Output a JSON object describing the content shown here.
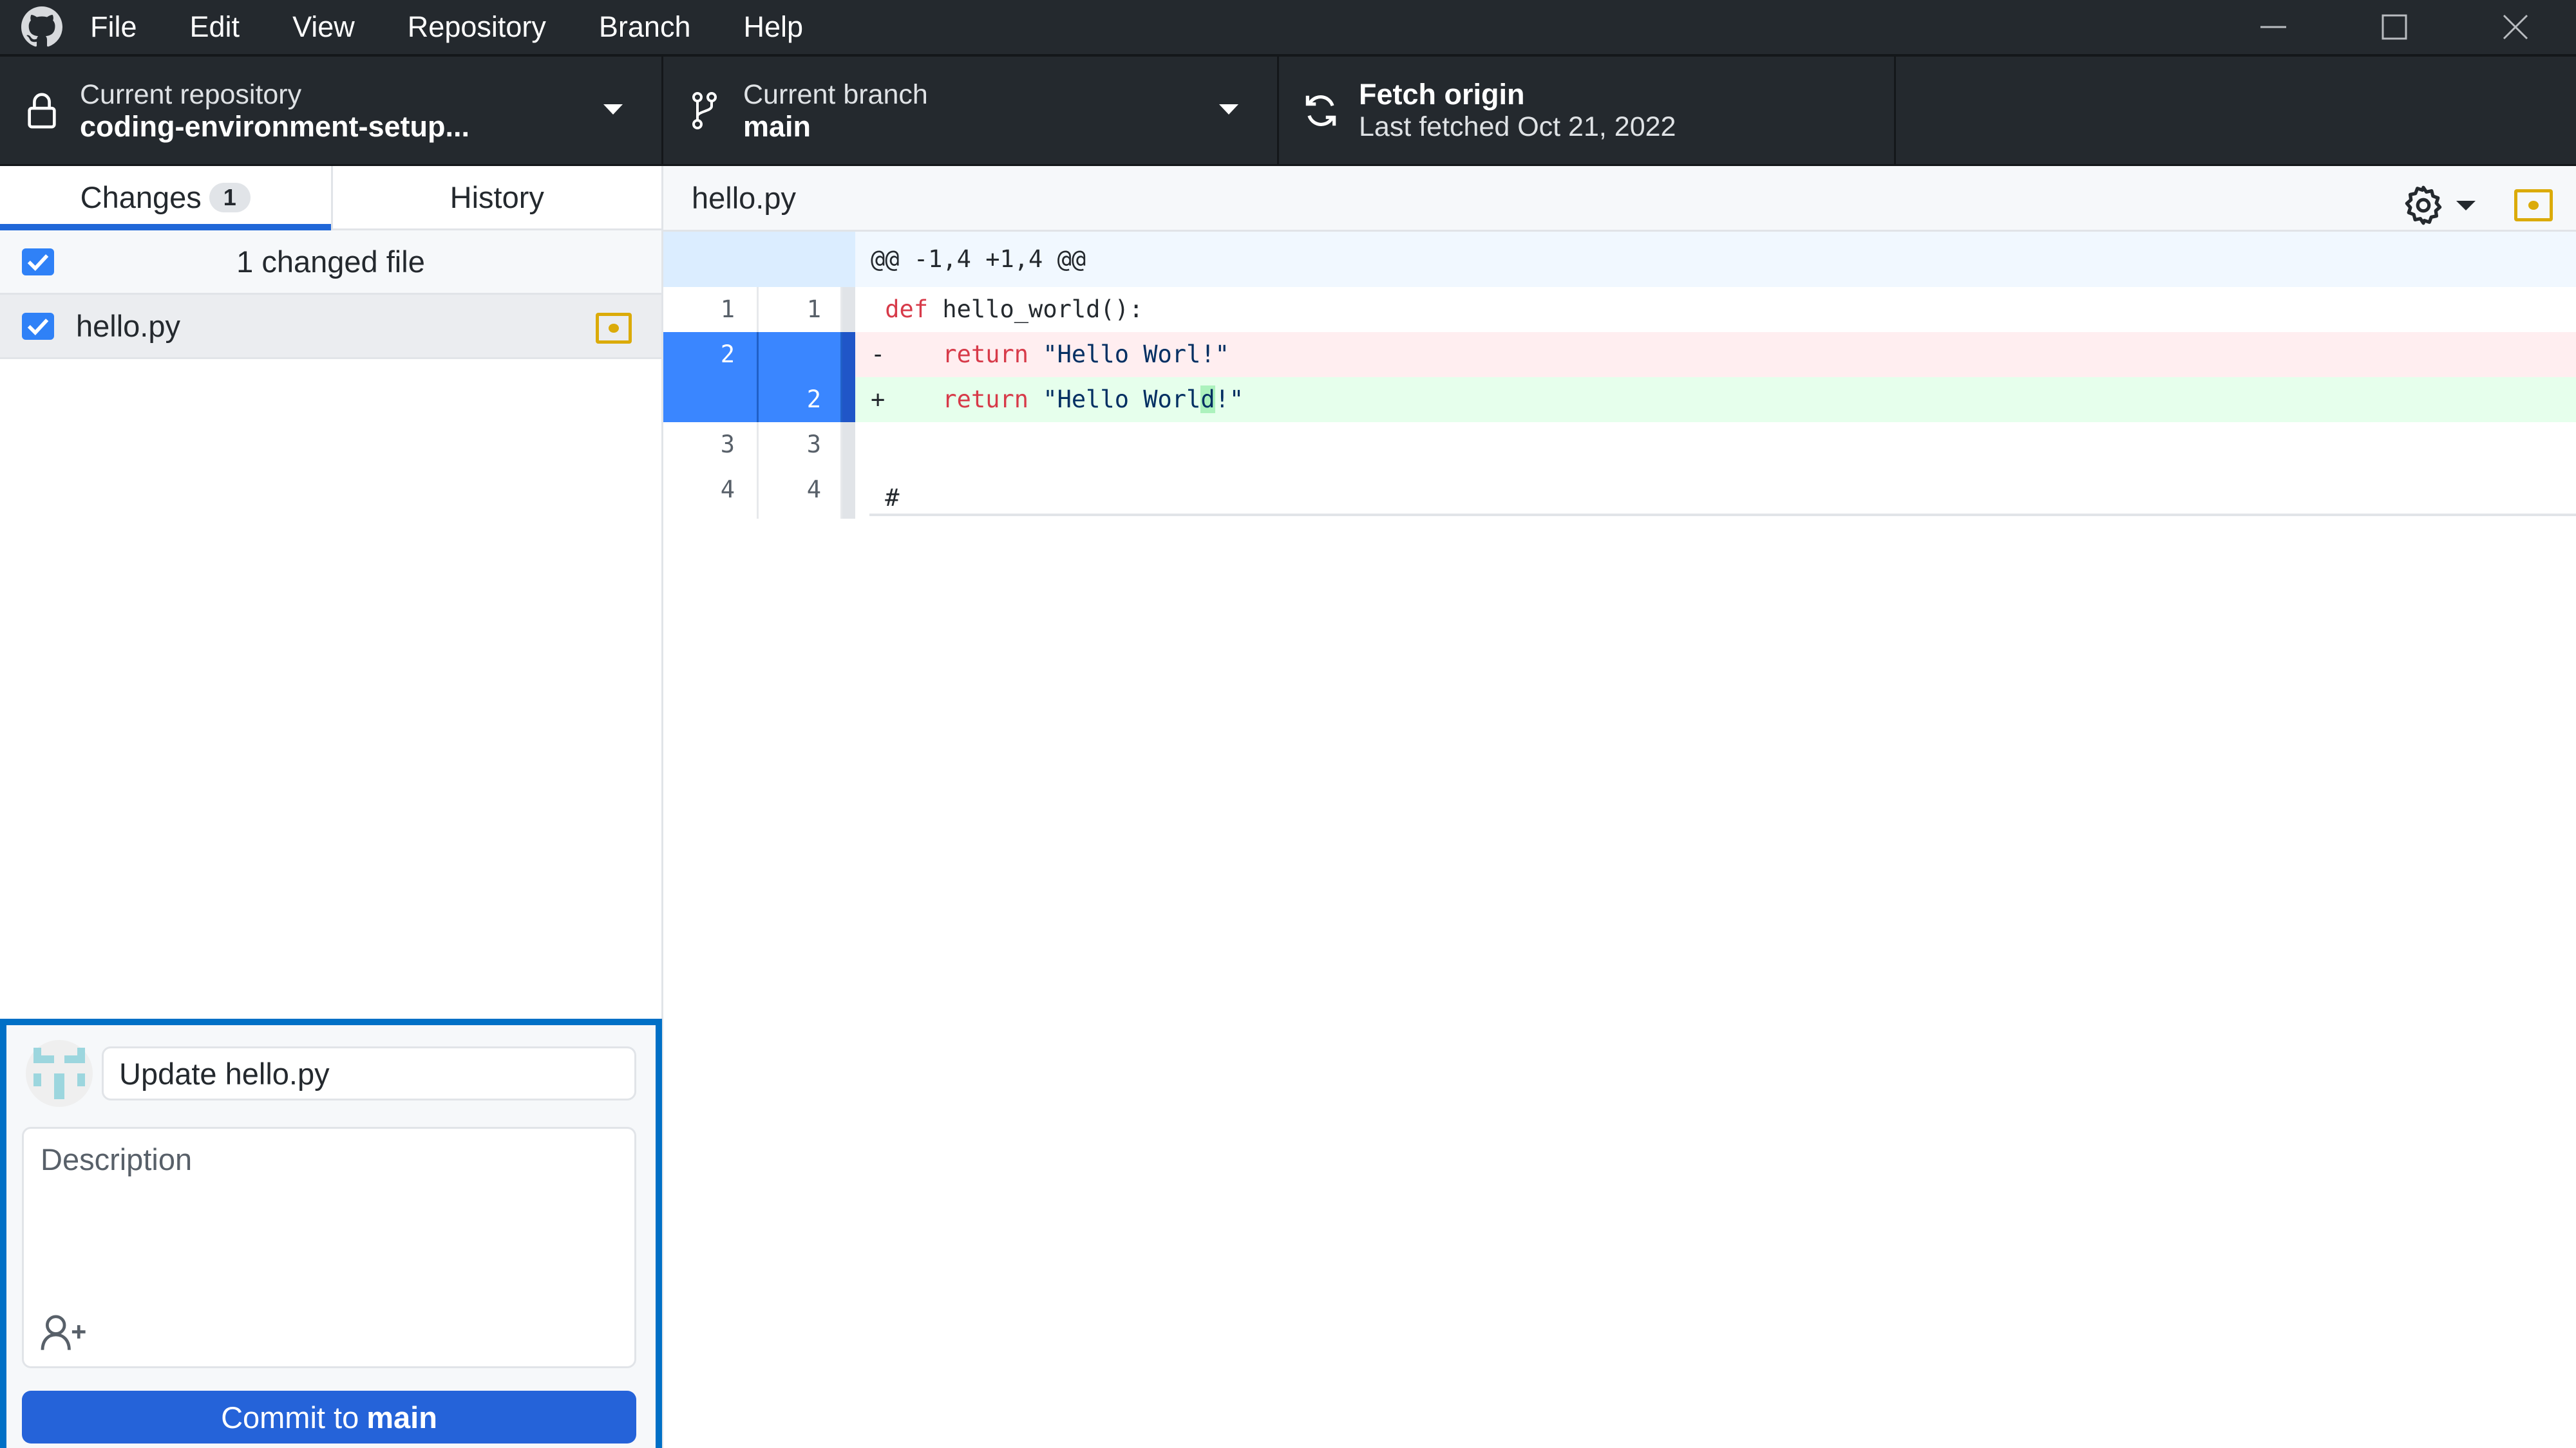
{
  "window": {
    "menu": [
      "File",
      "Edit",
      "View",
      "Repository",
      "Branch",
      "Help"
    ],
    "controls": [
      "minimize",
      "maximize",
      "close"
    ]
  },
  "toolbar": {
    "repository": {
      "label": "Current repository",
      "value": "coding-environment-setup..."
    },
    "branch": {
      "label": "Current branch",
      "value": "main"
    },
    "fetch": {
      "label": "Fetch origin",
      "value": "Last fetched Oct 21, 2022"
    }
  },
  "sidebar": {
    "tabs": [
      {
        "label": "Changes",
        "badge": "1",
        "active": true
      },
      {
        "label": "History",
        "active": false
      }
    ],
    "changed_header": "1 changed file",
    "files": [
      {
        "name": "hello.py",
        "checked": true,
        "status": "modified"
      }
    ]
  },
  "commit": {
    "summary_placeholder": "Update hello.py",
    "description_placeholder": "Description",
    "button_prefix": "Commit to",
    "button_branch": "main"
  },
  "diff": {
    "file": "hello.py",
    "hunk": "@@ -1,4 +1,4 @@",
    "lines": [
      {
        "old": "1",
        "new": "1",
        "type": "context",
        "marker": " ",
        "keyword": "def",
        "text": " hello_world():"
      },
      {
        "old": "2",
        "new": "",
        "type": "del",
        "marker": "-",
        "keyword": "return",
        "text": " \"Hello Worl!\""
      },
      {
        "old": "",
        "new": "2",
        "type": "add",
        "marker": "+",
        "keyword": "return",
        "text_before": " \"Hello Worl",
        "text_highlight": "d",
        "text_after": "!\""
      },
      {
        "old": "3",
        "new": "3",
        "type": "context",
        "text": ""
      },
      {
        "old": "4",
        "new": "4",
        "type": "context",
        "text": "#"
      }
    ]
  },
  "colors": {
    "accent": "#2067d8",
    "commit_button": "#2563d9",
    "modified": "#dbab09",
    "deletion_bg": "#ffeef0",
    "addition_bg": "#e6ffec",
    "selected_gutter": "#3a86ff"
  }
}
